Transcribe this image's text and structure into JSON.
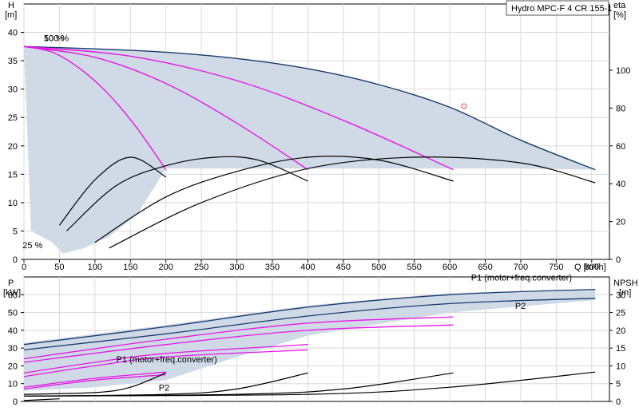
{
  "chart_data": [
    {
      "type": "line",
      "panel": "head",
      "title": "Hydro MPC-F 4 CR 155-1",
      "xlabel": "Q [m³/h]",
      "ylabel_left": [
        "H",
        "[m]"
      ],
      "ylabel_right": [
        "eta",
        "[%]"
      ],
      "xlim": [
        0,
        825
      ],
      "ylim": [
        0,
        45
      ],
      "eta_lim": [
        0,
        135
      ],
      "x_ticks": [
        0,
        50,
        100,
        150,
        200,
        250,
        300,
        350,
        400,
        450,
        500,
        550,
        600,
        650,
        700,
        750,
        800
      ],
      "y_ticks": [
        0,
        5,
        10,
        15,
        20,
        25,
        30,
        35,
        40
      ],
      "eta_ticks": [
        0,
        20,
        40,
        60,
        80,
        100
      ],
      "speed_labels": [
        "100 %",
        "50 %",
        "25 %"
      ],
      "duty_point": {
        "x": 620,
        "y": 27
      },
      "envelope_upper": {
        "x": [
          0,
          100,
          200,
          300,
          400,
          500,
          600,
          700,
          805
        ],
        "y": [
          37.5,
          37.1,
          36.5,
          35.4,
          33.6,
          30.8,
          26.8,
          21,
          15.8
        ]
      },
      "series": [
        {
          "color": "#1a3a6e",
          "x": [
            0,
            100,
            200,
            300,
            400,
            500,
            600,
            700,
            805
          ],
          "y": [
            37.5,
            37.1,
            36.5,
            35.4,
            33.6,
            30.8,
            26.8,
            21,
            15.8
          ]
        },
        {
          "color": "#e617e6",
          "x": [
            0,
            40,
            80,
            120,
            160,
            200
          ],
          "y": [
            37.5,
            36.5,
            33.5,
            29,
            23,
            15.8
          ]
        },
        {
          "color": "#e617e6",
          "x": [
            0,
            100,
            200,
            300,
            400
          ],
          "y": [
            37.5,
            35.6,
            31,
            24,
            15.8
          ]
        },
        {
          "color": "#e617e6",
          "x": [
            0,
            150,
            300,
            450,
            605
          ],
          "y": [
            37.5,
            35.8,
            31.5,
            24.5,
            15.8
          ]
        },
        {
          "color": "#000000",
          "x": [
            50,
            100,
            150,
            200
          ],
          "y": [
            6,
            14,
            18,
            14.5
          ]
        },
        {
          "color": "#000000",
          "x": [
            60,
            130,
            200,
            270,
            330,
            400
          ],
          "y": [
            5,
            13,
            16.5,
            18,
            17.5,
            13.8
          ]
        },
        {
          "color": "#000000",
          "x": [
            100,
            200,
            300,
            400,
            500,
            605
          ],
          "y": [
            3,
            11,
            15.5,
            18,
            17.5,
            13.8
          ]
        },
        {
          "color": "#000000",
          "x": [
            120,
            250,
            400,
            550,
            700,
            805
          ],
          "y": [
            2,
            10,
            16,
            18,
            17,
            13.5
          ]
        }
      ]
    },
    {
      "type": "line",
      "panel": "power",
      "ylabel_left": [
        "P",
        "[kW]"
      ],
      "ylabel_right": [
        "NPSH",
        "[m]"
      ],
      "xlim": [
        0,
        825
      ],
      "ylim": [
        0,
        70
      ],
      "npsh_lim": [
        0,
        35
      ],
      "y_ticks": [
        0,
        10,
        20,
        30,
        40,
        50,
        60
      ],
      "npsh_ticks": [
        0,
        5,
        10,
        15,
        20,
        25,
        30
      ],
      "annotations": [
        {
          "text": "P1 (motor+freq.converter)",
          "x": 130,
          "y": 22
        },
        {
          "text": "P2",
          "x": 190,
          "y": 6
        },
        {
          "text": "P1 (motor+freq.converter)",
          "x": 630,
          "y": 68
        },
        {
          "text": "P2",
          "x": 692,
          "y": 52
        }
      ],
      "series": [
        {
          "name": "P1 (motor+freq.converter)",
          "color": "#1a3a6e",
          "x": [
            0,
            200,
            400,
            600,
            805
          ],
          "y": [
            32,
            42,
            53,
            60,
            63
          ]
        },
        {
          "name": "P2",
          "color": "#1a3a6e",
          "x": [
            0,
            200,
            400,
            600,
            805
          ],
          "y": [
            29,
            38,
            48,
            55,
            58
          ]
        },
        {
          "color": "#e617e6",
          "x": [
            0,
            200,
            400,
            605
          ],
          "y": [
            24,
            35,
            44,
            47.5
          ]
        },
        {
          "color": "#e617e6",
          "x": [
            0,
            200,
            400,
            605
          ],
          "y": [
            22,
            32,
            40,
            43
          ]
        },
        {
          "color": "#e617e6",
          "x": [
            0,
            100,
            200,
            400
          ],
          "y": [
            16,
            22,
            27,
            32
          ]
        },
        {
          "color": "#e617e6",
          "x": [
            0,
            100,
            200,
            400
          ],
          "y": [
            14,
            20,
            25,
            29
          ]
        },
        {
          "color": "#e617e6",
          "x": [
            0,
            100,
            200
          ],
          "y": [
            8,
            13,
            16.5
          ]
        },
        {
          "color": "#e617e6",
          "x": [
            0,
            100,
            200
          ],
          "y": [
            7,
            12,
            15
          ]
        },
        {
          "color": "#000000",
          "x": [
            0,
            100,
            150,
            200
          ],
          "y": [
            4,
            5,
            8,
            16
          ]
        },
        {
          "color": "#000000",
          "x": [
            0,
            200,
            300,
            400
          ],
          "y": [
            3,
            4,
            7,
            16
          ]
        },
        {
          "color": "#000000",
          "x": [
            0,
            300,
            450,
            605
          ],
          "y": [
            3,
            4,
            7,
            16
          ]
        },
        {
          "color": "#000000",
          "x": [
            0,
            400,
            600,
            805
          ],
          "y": [
            3,
            4,
            8,
            16.5
          ]
        },
        {
          "color": "#000000",
          "x": [
            0,
            50
          ],
          "y": [
            0.5,
            1.5
          ]
        }
      ]
    }
  ]
}
